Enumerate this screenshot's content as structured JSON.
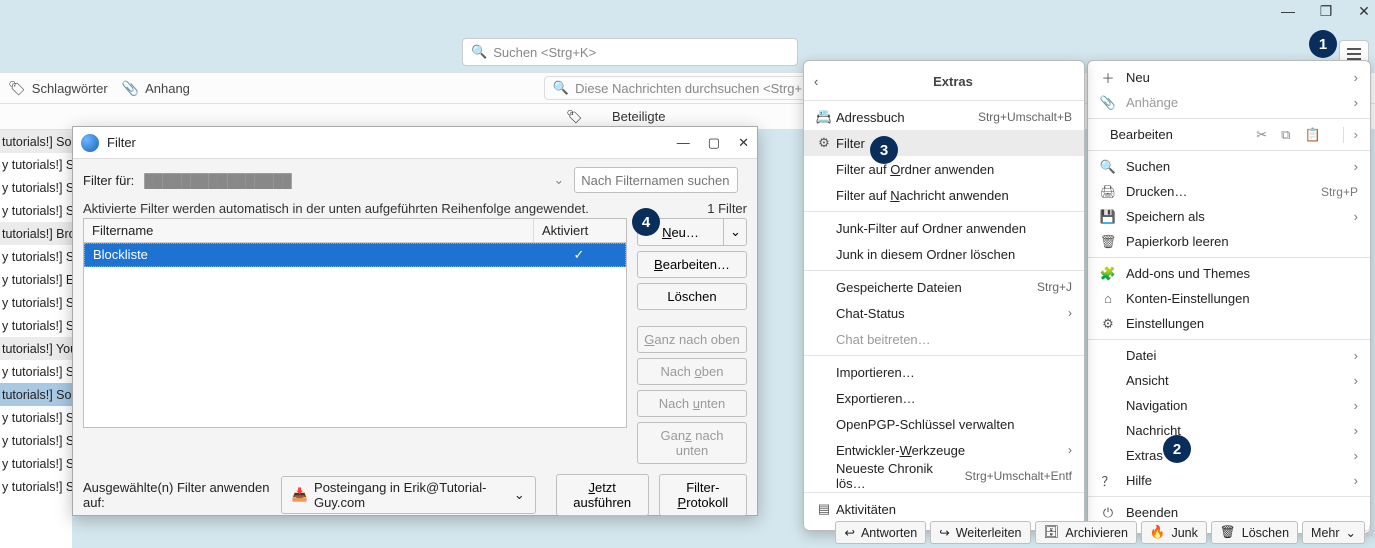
{
  "window_controls": {
    "min": "—",
    "max": "❐",
    "close": "✕"
  },
  "badges": {
    "b1": "1",
    "b2": "2",
    "b3": "3",
    "b4": "4"
  },
  "topsearch_placeholder": "Suchen <Strg+K>",
  "toolbar2": {
    "schlagworter": "Schlagwörter",
    "anhang": "Anhang",
    "quickfilter": "Diese Nachrichten durchsuchen <Strg+Umschalt+K>"
  },
  "colheader": {
    "beteiligte": "Beteiligte"
  },
  "msgrows": [
    {
      "t": "tutorials!] Sor",
      "a": true
    },
    {
      "t": "y tutorials!] S",
      "a": false
    },
    {
      "t": "y tutorials!] S",
      "a": false
    },
    {
      "t": "y tutorials!] S",
      "a": false
    },
    {
      "t": "tutorials!] Bro",
      "a": true
    },
    {
      "t": "y tutorials!] S",
      "a": false
    },
    {
      "t": "y tutorials!] E",
      "a": false
    },
    {
      "t": "y tutorials!] S",
      "a": false
    },
    {
      "t": "y tutorials!] S",
      "a": false
    },
    {
      "t": "tutorials!] You",
      "a": true
    },
    {
      "t": "y tutorials!] S",
      "a": false
    },
    {
      "t": "tutorials!] Sor",
      "sel": true
    },
    {
      "t": "y tutorials!] S",
      "a": false
    },
    {
      "t": "y tutorials!] S",
      "a": false
    },
    {
      "t": "y tutorials!] S",
      "a": false
    },
    {
      "t": "y tutorials!] S",
      "a": false
    }
  ],
  "main_menu": {
    "neu": "Neu",
    "anhaenge": "Anhänge",
    "bearbeiten": "Bearbeiten",
    "suchen": "Suchen",
    "drucken": "Drucken…",
    "drucken_sc": "Strg+P",
    "speichern": "Speichern als",
    "papierkorb": "Papierkorb leeren",
    "addons": "Add-ons und Themes",
    "konten": "Konten-Einstellungen",
    "einstellungen": "Einstellungen",
    "datei": "Datei",
    "ansicht": "Ansicht",
    "navigation": "Navigation",
    "nachricht": "Nachricht",
    "extras": "Extras",
    "hilfe": "Hilfe",
    "beenden": "Beenden"
  },
  "extras_menu": {
    "title": "Extras",
    "adressbuch": "Adressbuch",
    "adressbuch_sc": "Strg+Umschalt+B",
    "filter": "Filter",
    "filter_ordner": "Filter auf Ordner anwenden",
    "filter_nachricht": "Filter auf Nachricht anwenden",
    "junk_ordner": "Junk-Filter auf Ordner anwenden",
    "junk_loeschen": "Junk in diesem Ordner löschen",
    "gespeicherte": "Gespeicherte Dateien",
    "gespeicherte_sc": "Strg+J",
    "chat_status": "Chat-Status",
    "chat_beitreten": "Chat beitreten…",
    "importieren": "Importieren…",
    "exportieren": "Exportieren…",
    "openpgp": "OpenPGP-Schlüssel verwalten",
    "entwickler": "Entwickler-Werkzeuge",
    "chronik": "Neueste Chronik lös…",
    "chronik_sc": "Strg+Umschalt+Entf",
    "aktivitaeten": "Aktivitäten"
  },
  "filterwin": {
    "title": "Filter",
    "filter_fuer": "Filter für:",
    "account_blurred": "████████████████",
    "search_placeholder": "Nach Filternamen suchen…",
    "note": "Aktivierte Filter werden automatisch in der unten aufgeführten Reihenfolge angewendet.",
    "count": "1 Filter",
    "col_name": "Filtername",
    "col_active": "Aktiviert",
    "row_name": "Blockliste",
    "row_check": "✓",
    "btn_neu": "Neu…",
    "btn_bearb": "Bearbeiten…",
    "btn_loeschen": "Löschen",
    "btn_top": "Ganz nach oben",
    "btn_up": "Nach oben",
    "btn_down": "Nach unten",
    "btn_bottom": "Ganz nach unten",
    "apply_label": "Ausgewählte(n) Filter anwenden auf:",
    "apply_target": "Posteingang in Erik@Tutorial-Guy.com",
    "btn_exec": "Jetzt ausführen",
    "btn_proto": "Filter-Protokoll"
  },
  "actbar": {
    "antworten": "Antworten",
    "weiter": "Weiterleiten",
    "arch": "Archivieren",
    "junk": "Junk",
    "loeschen": "Löschen",
    "mehr": "Mehr"
  }
}
